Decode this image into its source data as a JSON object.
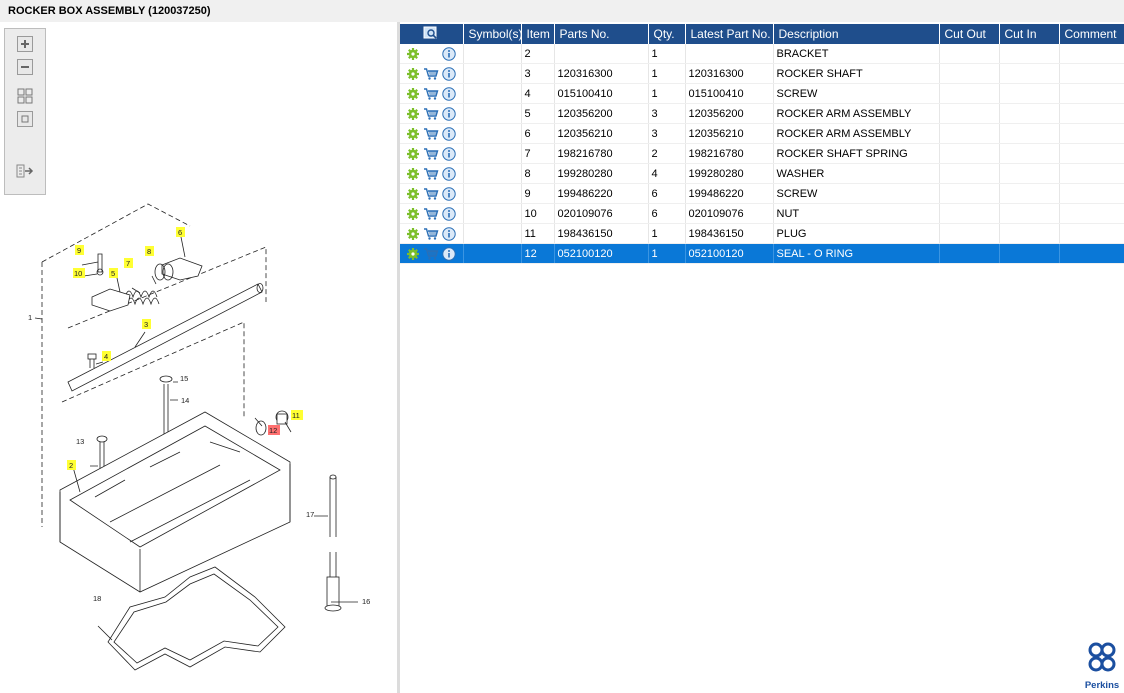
{
  "title": "ROCKER BOX ASSEMBLY (120037250)",
  "columns": [
    "",
    "Symbol(s)",
    "Item",
    "Parts No.",
    "Qty.",
    "Latest Part No.",
    "Description",
    "Cut Out",
    "Cut In",
    "Comment"
  ],
  "rows": [
    {
      "item": "2",
      "part_no": "",
      "qty": "1",
      "latest": "",
      "desc": "BRACKET",
      "cart": false,
      "selected": false
    },
    {
      "item": "3",
      "part_no": "120316300",
      "qty": "1",
      "latest": "120316300",
      "desc": "ROCKER SHAFT",
      "cart": true,
      "selected": false
    },
    {
      "item": "4",
      "part_no": "015100410",
      "qty": "1",
      "latest": "015100410",
      "desc": "SCREW",
      "cart": true,
      "selected": false
    },
    {
      "item": "5",
      "part_no": "120356200",
      "qty": "3",
      "latest": "120356200",
      "desc": "ROCKER ARM ASSEMBLY",
      "cart": true,
      "selected": false
    },
    {
      "item": "6",
      "part_no": "120356210",
      "qty": "3",
      "latest": "120356210",
      "desc": "ROCKER ARM ASSEMBLY",
      "cart": true,
      "selected": false
    },
    {
      "item": "7",
      "part_no": "198216780",
      "qty": "2",
      "latest": "198216780",
      "desc": "ROCKER SHAFT SPRING",
      "cart": true,
      "selected": false
    },
    {
      "item": "8",
      "part_no": "199280280",
      "qty": "4",
      "latest": "199280280",
      "desc": "WASHER",
      "cart": true,
      "selected": false
    },
    {
      "item": "9",
      "part_no": "199486220",
      "qty": "6",
      "latest": "199486220",
      "desc": "SCREW",
      "cart": true,
      "selected": false
    },
    {
      "item": "10",
      "part_no": "020109076",
      "qty": "6",
      "latest": "020109076",
      "desc": "NUT",
      "cart": true,
      "selected": false
    },
    {
      "item": "11",
      "part_no": "198436150",
      "qty": "1",
      "latest": "198436150",
      "desc": "PLUG",
      "cart": true,
      "selected": false
    },
    {
      "item": "12",
      "part_no": "052100120",
      "qty": "1",
      "latest": "052100120",
      "desc": "SEAL - O RING",
      "cart": true,
      "selected": true
    }
  ],
  "toolbar": {
    "zoom_in": "zoom-in",
    "zoom_out": "zoom-out",
    "fit_all": "fit-all",
    "fit_window": "fit-window",
    "export": "export"
  },
  "diagram": {
    "callouts": [
      "1",
      "2",
      "3",
      "4",
      "5",
      "6",
      "7",
      "8",
      "9",
      "10",
      "11",
      "12",
      "13",
      "14",
      "15",
      "16",
      "17",
      "18"
    ],
    "highlighted": [
      "2",
      "3",
      "4",
      "5",
      "6",
      "7",
      "8",
      "9",
      "10",
      "11"
    ],
    "selected_callout": "12"
  },
  "brand": {
    "name": "Perkins",
    "color": "#1b4fa0"
  },
  "colors": {
    "header_bg": "#1f4e8c",
    "selected_row": "#0a78d7",
    "callout_yellow": "#ffff33",
    "callout_selected": "#ff7070"
  }
}
